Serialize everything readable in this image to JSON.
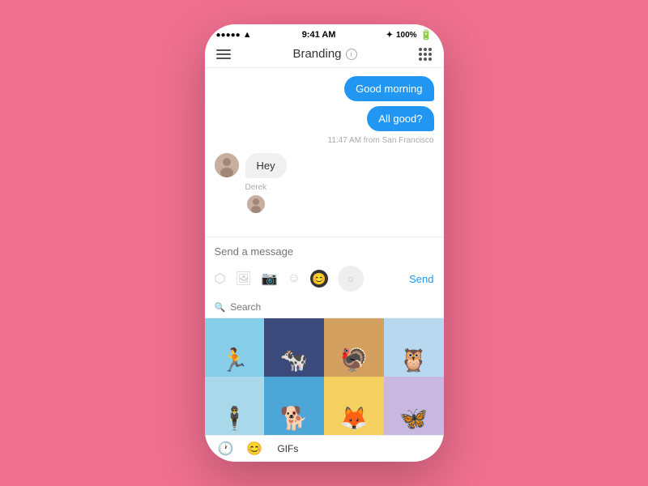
{
  "statusBar": {
    "signals": [
      "●",
      "●",
      "●",
      "●",
      "●"
    ],
    "time": "9:41 AM",
    "battery": "100%"
  },
  "navBar": {
    "menuLabel": "menu",
    "title": "Branding",
    "gridLabel": "grid"
  },
  "messages": [
    {
      "id": 1,
      "type": "sent",
      "text": "Good morning"
    },
    {
      "id": 2,
      "type": "sent",
      "text": "All good?"
    },
    {
      "id": 3,
      "type": "timestamp",
      "text": "11:47 AM from San Francisco"
    },
    {
      "id": 4,
      "type": "received",
      "sender": "Derek",
      "text": "Hey"
    }
  ],
  "inputPlaceholder": "Send a message",
  "sendLabel": "Send",
  "gifSearch": {
    "placeholder": "Search"
  },
  "bottomTabs": [
    {
      "id": "clock",
      "icon": "🕐"
    },
    {
      "id": "emoji",
      "icon": "😊"
    },
    {
      "id": "gifs",
      "label": "GIFs"
    }
  ],
  "stickerRows": [
    [
      {
        "color": "sc-blue",
        "figure": "🏃"
      },
      {
        "color": "sc-darkblue",
        "figure": "🐄"
      },
      {
        "color": "sc-brown",
        "figure": "🦃"
      },
      {
        "color": "sc-sky",
        "figure": "🦉"
      }
    ],
    [
      {
        "color": "sc-lightblue",
        "figure": "🕴"
      },
      {
        "color": "sc-blue2",
        "figure": "🐕"
      },
      {
        "color": "sc-yellow",
        "figure": "🦊"
      },
      {
        "color": "sc-lavender",
        "figure": "🦋"
      }
    ]
  ]
}
